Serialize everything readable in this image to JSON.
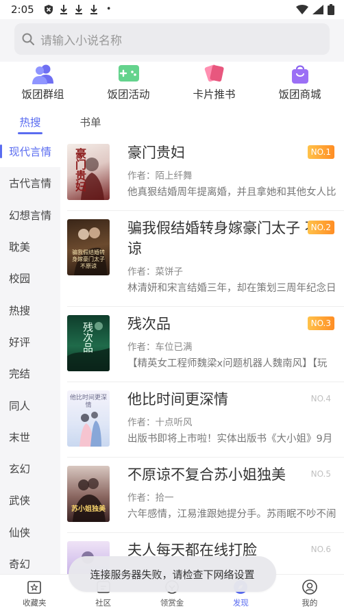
{
  "status_bar": {
    "time": "2:05",
    "dot": "•"
  },
  "search": {
    "placeholder": "请输入小说名称"
  },
  "quick_nav": [
    {
      "label": "饭团群组",
      "icon": "group-icon"
    },
    {
      "label": "饭团活动",
      "icon": "activity-icon"
    },
    {
      "label": "卡片推书",
      "icon": "cards-icon"
    },
    {
      "label": "饭团商城",
      "icon": "shop-bag-icon"
    }
  ],
  "tabs": [
    {
      "label": "热搜",
      "active": true
    },
    {
      "label": "书单",
      "active": false
    }
  ],
  "categories": [
    "现代言情",
    "古代言情",
    "幻想言情",
    "耽美",
    "校园",
    "热搜",
    "好评",
    "完结",
    "同人",
    "末世",
    "玄幻",
    "武侠",
    "仙侠",
    "奇幻"
  ],
  "books": [
    {
      "title": "豪门贵妇",
      "author": "作者：陌上纤舞",
      "desc": "他真狠结婚周年提离婚，并且拿她和其他女人比",
      "rank": "NO.1",
      "cover_text": "豪门贵妇"
    },
    {
      "title": "骗我假结婚转身嫁豪门太子 不原谅",
      "author": "作者：菜饼子",
      "desc": "林清妍和宋言结婚三年，却在策划三周年纪念日",
      "rank": "NO.2",
      "cover_text": "骗我假结婚转身嫁豪门太子不原谅"
    },
    {
      "title": "残次品",
      "author": "作者：车位已满",
      "desc": "【精英女工程师魏梁x问题机器人魏南风】【玩",
      "rank": "NO.3",
      "cover_text": "残次品"
    },
    {
      "title": "他比时间更深情",
      "author": "作者：十点听风",
      "desc": "出版书即将上市啦！实体出版书《大小姐》9月",
      "rank": "NO.4",
      "cover_text": "他比时间更深情"
    },
    {
      "title": "不原谅不复合苏小姐独美",
      "author": "作者：拾一",
      "desc": "六年感情，江易淮跟她提分手。苏雨眠不吵不闹",
      "rank": "NO.5",
      "cover_text": "苏小姐独美"
    },
    {
      "title": "夫人每天都在线打脸",
      "author": "",
      "desc": "",
      "rank": "NO.6",
      "cover_text": ""
    }
  ],
  "bottom_nav": [
    {
      "label": "收藏夹",
      "icon": "bookshelf-icon",
      "active": false
    },
    {
      "label": "社区",
      "icon": "community-icon",
      "active": false
    },
    {
      "label": "领赏金",
      "icon": "reward-icon",
      "active": false
    },
    {
      "label": "发现",
      "icon": "discover-icon",
      "active": true
    },
    {
      "label": "我的",
      "icon": "profile-icon",
      "active": false
    }
  ],
  "toast": {
    "message": "连接服务器失败，请检查下网络设置"
  },
  "colors": {
    "accent": "#5a6cf0",
    "rank_top": "#ff9a2a",
    "sidebar_bg": "#f5f5f7"
  }
}
